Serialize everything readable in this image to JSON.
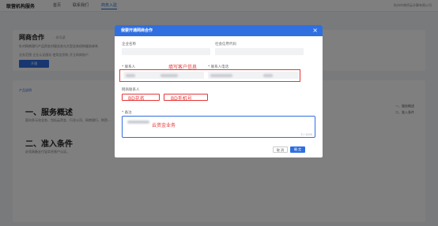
{
  "topbar": {
    "brand": "联营机构服务",
    "nav": [
      "首页",
      "联系我们",
      "商务入驻"
    ],
    "active_nav": "商务入驻",
    "right_text": "杭州市商桥云计算有限公司"
  },
  "intro": {
    "title": "网商合作",
    "tag": "· 非可读",
    "desc": "针对网商银行产品资金对接业务与大型业务机构服务体系",
    "meta": "业务范围     企业认证服务     使用信息和   开立网商账户",
    "button": "开通"
  },
  "content": {
    "sub_label": "产品说明",
    "section1": "一、服务概述",
    "section1_text": "面向多元化业务、包括云资金、行业公司、网商银行、财资...",
    "section2": "二、准入条件",
    "section2_text": "必须具备支付宝实名账户认证。",
    "side": [
      "一、服务概述",
      "二、准入条件"
    ]
  },
  "dialog": {
    "title": "我要开通网商合作",
    "close": "×",
    "label_company": "企业名称",
    "label_credit": "社会信用代码",
    "label_contact": "* 联系人",
    "label_phone": "* 联系人电话",
    "label_bd_contact": "网商联系人",
    "label_remark": "* 备注",
    "annotation_customer": "填写客户信息",
    "annotation_bd_name": "BD花名",
    "annotation_bd_phone": "BD手机号",
    "annotation_remark": "云资金业务",
    "counter": "5 / 1000",
    "cancel": "取 消",
    "confirm": "确 定"
  },
  "colors": {
    "primary": "#2f6fe0",
    "annotation_red": "#e63535",
    "overlay": "rgba(0,0,0,0.50)"
  }
}
